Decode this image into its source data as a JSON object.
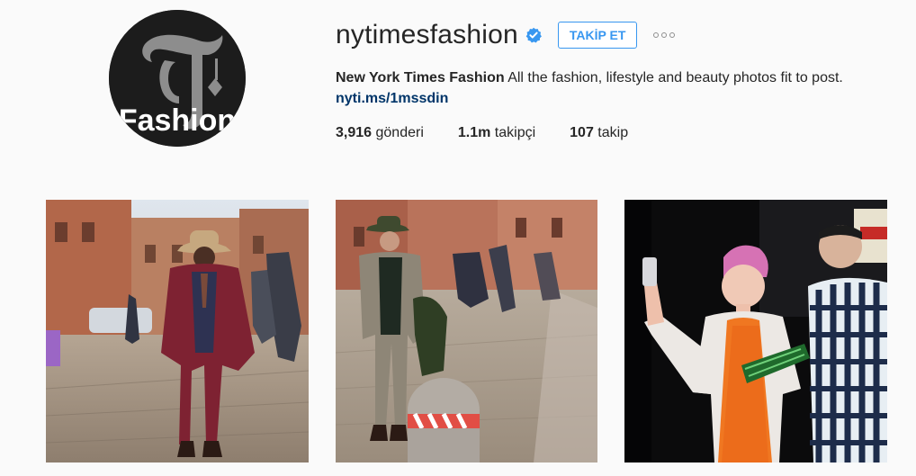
{
  "profile": {
    "username": "nytimesfashion",
    "verified": true,
    "follow_label": "TAKİP ET",
    "more_label": "...",
    "full_name": "New York Times Fashion",
    "bio": " All the fashion, lifestyle and beauty photos fit to post.",
    "link": "nyti.ms/1mssdin",
    "avatar_text": "Fashion"
  },
  "stats": {
    "posts_count": "3,916",
    "posts_label": " gönderi",
    "followers_count": "1.1m",
    "followers_label": " takipçi",
    "following_count": "107",
    "following_label": " takip"
  },
  "colors": {
    "accent": "#3897f0",
    "link": "#003569",
    "verified_badge": "#3897f0",
    "background": "#fafafa"
  },
  "icons": [
    "verified-badge-icon",
    "more-options-icon"
  ],
  "posts": [
    {
      "name": "post-street-style-burgundy-coat"
    },
    {
      "name": "post-street-style-tweed-jacket"
    },
    {
      "name": "post-selfie-pink-hair"
    }
  ]
}
